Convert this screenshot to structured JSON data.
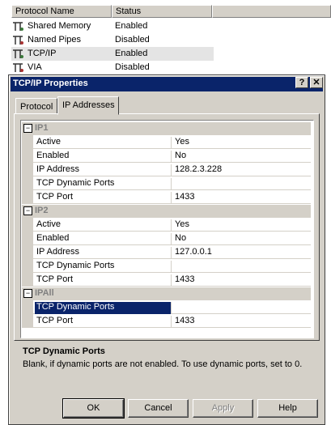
{
  "list": {
    "columns": [
      "Protocol Name",
      "Status"
    ],
    "rows": [
      {
        "name": "Shared Memory",
        "status": "Enabled"
      },
      {
        "name": "Named Pipes",
        "status": "Disabled"
      },
      {
        "name": "TCP/IP",
        "status": "Enabled"
      },
      {
        "name": "VIA",
        "status": "Disabled"
      }
    ],
    "row_icon": "protocol-icon"
  },
  "dialog": {
    "title": "TCP/IP Properties",
    "help_glyph": "?",
    "close_glyph": "✕",
    "tabs": [
      "Protocol",
      "IP Addresses"
    ],
    "grid": {
      "ip1": {
        "header": "IP1",
        "rows": [
          {
            "name": "Active",
            "value": "Yes"
          },
          {
            "name": "Enabled",
            "value": "No"
          },
          {
            "name": "IP Address",
            "value": "128.2.3.228"
          },
          {
            "name": "TCP Dynamic Ports",
            "value": ""
          },
          {
            "name": "TCP Port",
            "value": "1433"
          }
        ]
      },
      "ip2": {
        "header": "IP2",
        "rows": [
          {
            "name": "Active",
            "value": "Yes"
          },
          {
            "name": "Enabled",
            "value": "No"
          },
          {
            "name": "IP Address",
            "value": "127.0.0.1"
          },
          {
            "name": "TCP Dynamic Ports",
            "value": ""
          },
          {
            "name": "TCP Port",
            "value": "1433"
          }
        ]
      },
      "ipall": {
        "header": "IPAll",
        "rows": [
          {
            "name": "TCP Dynamic Ports",
            "value": ""
          },
          {
            "name": "TCP Port",
            "value": "1433"
          }
        ]
      },
      "collapse_glyph": "−"
    },
    "description": {
      "title": "TCP Dynamic Ports",
      "text": "Blank, if dynamic ports are not enabled. To use dynamic ports, set to 0."
    },
    "buttons": {
      "ok": "OK",
      "cancel": "Cancel",
      "apply": "Apply",
      "help": "Help"
    }
  },
  "colors": {
    "titlebar": "#0a246a",
    "selection": "#0a246a",
    "face": "#d4d0c8"
  }
}
